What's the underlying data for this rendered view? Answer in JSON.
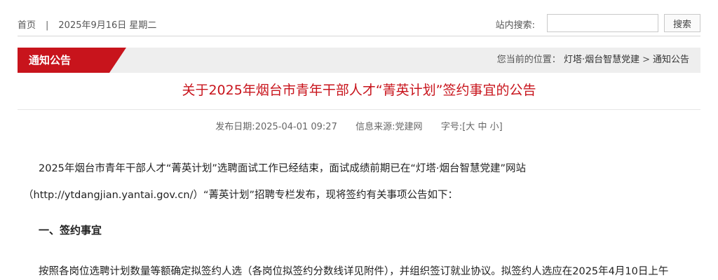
{
  "topbar": {
    "home_label": "首页",
    "separator": "|",
    "date_text": "2025年9月16日 星期二",
    "search_label": "站内搜索:",
    "search_value": "",
    "search_button": "搜索"
  },
  "section": {
    "tab_label": "通知公告",
    "location_label": "您当前的位置：",
    "crumbs": [
      "灯塔·烟台智慧党建",
      "通知公告"
    ],
    "crumb_separator": ">"
  },
  "article": {
    "title": "关于2025年烟台市青年干部人才“菁英计划”签约事宜的公告",
    "meta": {
      "publish_label": "发布日期:",
      "publish_date": "2025-04-01 09:27",
      "source_label": "信息来源:",
      "source": "党建网",
      "font_label": "字号:",
      "bracket_open": "[",
      "size_large": "大",
      "size_medium": "中",
      "size_small": "小",
      "bracket_close": "]"
    },
    "paragraph1_line1": "2025年烟台市青年干部人才“菁英计划”选聘面试工作已经结束，面试成绩前期已在“灯塔·烟台智慧党建”网站",
    "paragraph1_line2": "（http://ytdangjian.yantai.gov.cn/）“菁英计划”招聘专栏发布，现将签约有关事项公告如下：",
    "heading1": "一、签约事宜",
    "paragraph2": "按照各岗位选聘计划数量等额确定拟签约人选（各岗位拟签约分数线详见附件），并组织签订就业协议。拟签约人选应在2025年4月10日上午"
  },
  "colors": {
    "accent_red": "#c8141c",
    "bar_gray": "#eeeeee"
  }
}
